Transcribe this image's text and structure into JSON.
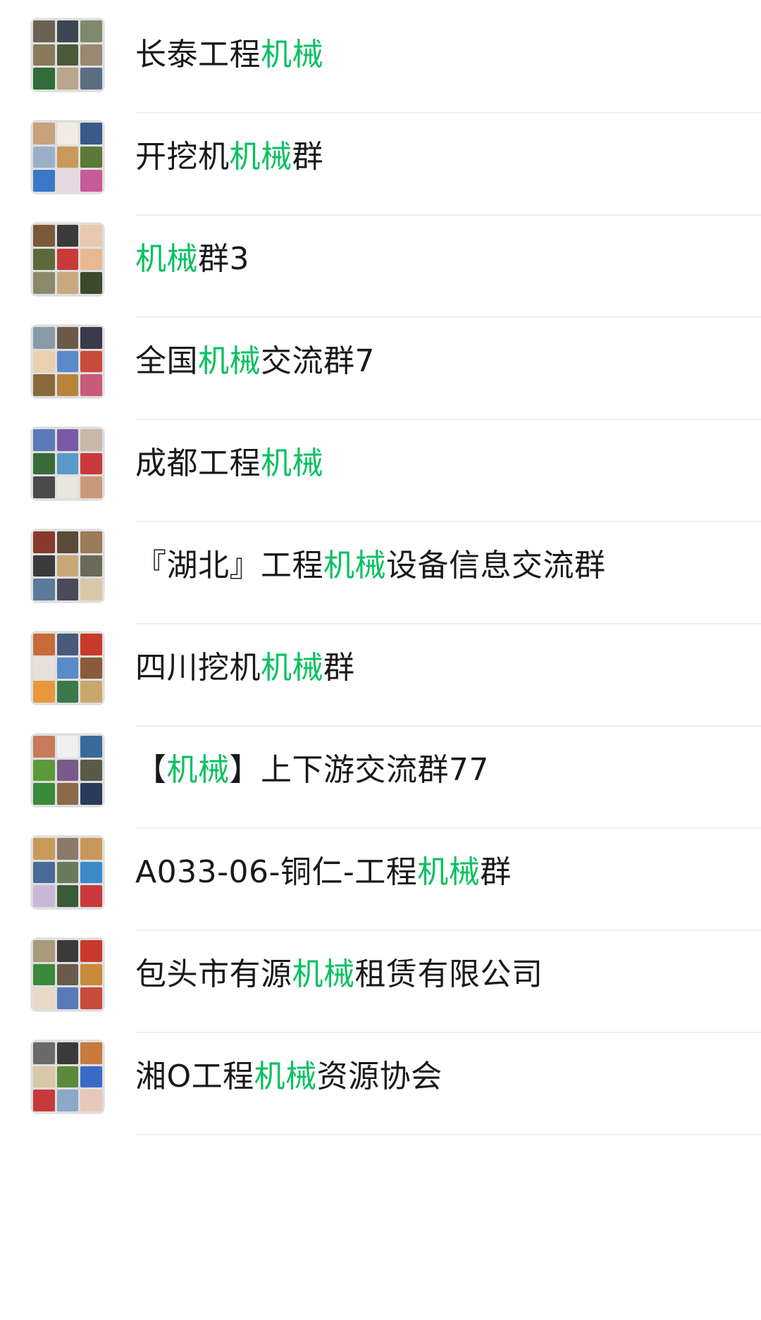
{
  "accent_color": "#07c160",
  "search_keyword": "机械",
  "results": [
    {
      "parts": [
        {
          "t": "长泰工程",
          "hl": false
        },
        {
          "t": "机械",
          "hl": true
        }
      ],
      "tiles": [
        "#6b6254",
        "#3d4550",
        "#7d8a6e",
        "#8a7a5a",
        "#4a5a3a",
        "#9a8870",
        "#2f6d3a",
        "#b9a48c",
        "#5b6e82"
      ]
    },
    {
      "parts": [
        {
          "t": "开挖机",
          "hl": false
        },
        {
          "t": "机械",
          "hl": true
        },
        {
          "t": "群",
          "hl": false
        }
      ],
      "tiles": [
        "#c8a27a",
        "#f0ece4",
        "#3a5a8a",
        "#9ab0c8",
        "#c89a5a",
        "#5a7a3a",
        "#3a78c8",
        "#e8d8e0",
        "#c85a9a"
      ]
    },
    {
      "parts": [
        {
          "t": "机械",
          "hl": true
        },
        {
          "t": "群3",
          "hl": false
        }
      ],
      "tiles": [
        "#7a5a3a",
        "#3a3a3a",
        "#e8c8b0",
        "#5a6a3a",
        "#c83a3a",
        "#e8b890",
        "#8a8a6a",
        "#c8a880",
        "#3a4a2a"
      ]
    },
    {
      "parts": [
        {
          "t": "全国",
          "hl": false
        },
        {
          "t": "机械",
          "hl": true
        },
        {
          "t": "交流群7",
          "hl": false
        }
      ],
      "tiles": [
        "#8a9aa8",
        "#6a5a4a",
        "#3a3a4a",
        "#e8d0b0",
        "#5a8ac8",
        "#c84a3a",
        "#8a6a3a",
        "#b8843a",
        "#c85a7a"
      ]
    },
    {
      "parts": [
        {
          "t": "成都工程",
          "hl": false
        },
        {
          "t": "机械",
          "hl": true
        }
      ],
      "tiles": [
        "#5a7ab8",
        "#7a5aa8",
        "#c8b8a8",
        "#3a6a3a",
        "#5a9ac8",
        "#c83a3a",
        "#4a4a4a",
        "#e8e8e0",
        "#c89a7a"
      ]
    },
    {
      "parts": [
        {
          "t": "『湖北』工程",
          "hl": false
        },
        {
          "t": "机械",
          "hl": true
        },
        {
          "t": "设备信息交流群",
          "hl": false
        }
      ],
      "tiles": [
        "#8a3a2a",
        "#5a4a3a",
        "#9a7a5a",
        "#3a3a3a",
        "#c8a878",
        "#6a6a5a",
        "#5a7a9a",
        "#4a4a5a",
        "#d8c8a8"
      ]
    },
    {
      "parts": [
        {
          "t": "四川挖机",
          "hl": false
        },
        {
          "t": "机械",
          "hl": true
        },
        {
          "t": "群",
          "hl": false
        }
      ],
      "tiles": [
        "#c86a3a",
        "#4a5a7a",
        "#c83a2a",
        "#e8e0d8",
        "#5a8ac8",
        "#8a5a3a",
        "#e8983a",
        "#3a7a4a",
        "#c8a86a"
      ]
    },
    {
      "parts": [
        {
          "t": "【",
          "hl": false
        },
        {
          "t": "机械",
          "hl": true
        },
        {
          "t": "】上下游交流群77",
          "hl": false
        }
      ],
      "tiles": [
        "#c87a5a",
        "#f0f0f0",
        "#3a6a9a",
        "#5a9a3a",
        "#7a5a8a",
        "#5a5a4a",
        "#3a8a3a",
        "#8a6a4a",
        "#2a3a5a"
      ]
    },
    {
      "parts": [
        {
          "t": "A033-06-铜仁-工程",
          "hl": false
        },
        {
          "t": "机械",
          "hl": true
        },
        {
          "t": "群",
          "hl": false
        }
      ],
      "tiles": [
        "#c89a5a",
        "#8a7a6a",
        "#c8985a",
        "#4a6a9a",
        "#6a7a5a",
        "#3a8ac8",
        "#c8b8d8",
        "#3a5a3a",
        "#c83a3a"
      ]
    },
    {
      "parts": [
        {
          "t": "包头市有源",
          "hl": false
        },
        {
          "t": "机械",
          "hl": true
        },
        {
          "t": "租赁有限公司",
          "hl": false
        }
      ],
      "tiles": [
        "#a89a7a",
        "#3a3a3a",
        "#c83a2a",
        "#3a8a3a",
        "#6a5a4a",
        "#c88a3a",
        "#e8d8c8",
        "#5a7ab8",
        "#c84a3a"
      ]
    },
    {
      "parts": [
        {
          "t": "湘O工程",
          "hl": false
        },
        {
          "t": "机械",
          "hl": true
        },
        {
          "t": "资源协会",
          "hl": false
        }
      ],
      "tiles": [
        "#6a6a6a",
        "#3a3a3a",
        "#c87a3a",
        "#d8c8a8",
        "#5a8a3a",
        "#3a6ac8",
        "#c83a3a",
        "#8aa8c8",
        "#e8c8b8"
      ]
    }
  ]
}
